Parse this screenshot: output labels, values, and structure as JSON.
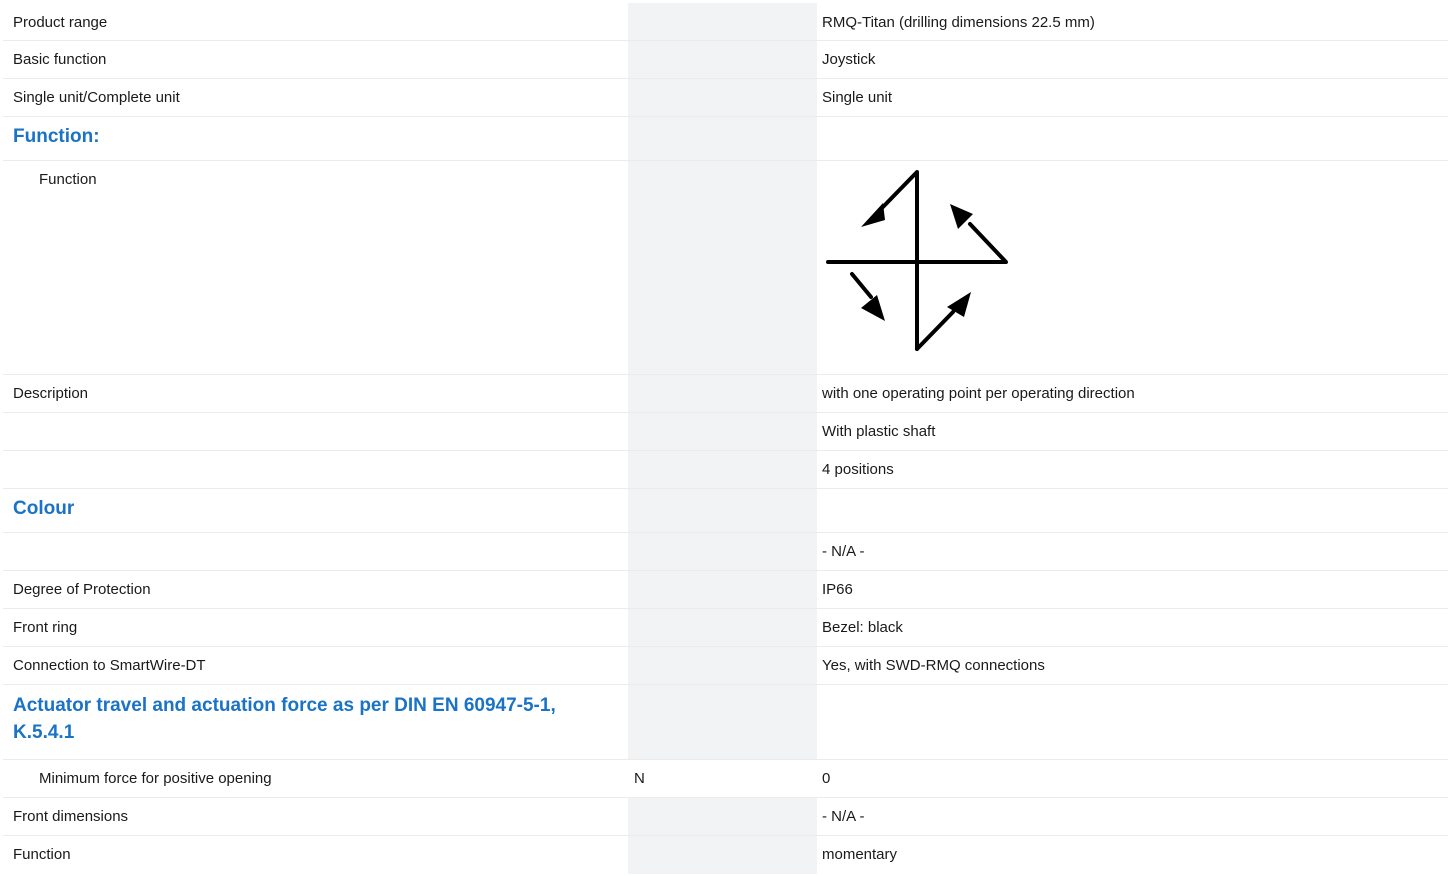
{
  "rows": [
    {
      "label": "Product range",
      "unit": "",
      "value": "RMQ-Titan (drilling dimensions 22.5 mm)"
    },
    {
      "label": "Basic function",
      "unit": "",
      "value": "Joystick"
    },
    {
      "label": "Single unit/Complete unit",
      "unit": "",
      "value": "Single unit"
    },
    {
      "heading": "Function:"
    },
    {
      "label": "Function",
      "unit": "",
      "figure": "joystick-4-direction-icon"
    },
    {
      "label": "Description",
      "unit": "",
      "value": "with one operating point per operating direction"
    },
    {
      "label": "",
      "unit": "",
      "value": "With plastic shaft"
    },
    {
      "label": "",
      "unit": "",
      "value": "4 positions"
    },
    {
      "heading": "Colour"
    },
    {
      "label": "",
      "unit": "",
      "value": "- N/A -"
    },
    {
      "label": "Degree of Protection",
      "unit": "",
      "value": "IP66"
    },
    {
      "label": "Front ring",
      "unit": "",
      "value": "Bezel: black"
    },
    {
      "label": "Connection to SmartWire-DT",
      "unit": "",
      "value": "Yes, with SWD-RMQ connections"
    },
    {
      "heading": "Actuator travel and actuation force as per DIN EN 60947-5-1, K.5.4.1"
    },
    {
      "label": "Minimum force for positive opening",
      "unit": "N",
      "value": "0"
    },
    {
      "label": "Front dimensions",
      "unit": "",
      "value": "- N/A -"
    },
    {
      "label": "Function",
      "unit": "",
      "value": "momentary"
    }
  ],
  "colors": {
    "heading": "#1a73c6",
    "unit_column_bg": "#f1f3f5",
    "row_divider": "#ebebeb"
  }
}
